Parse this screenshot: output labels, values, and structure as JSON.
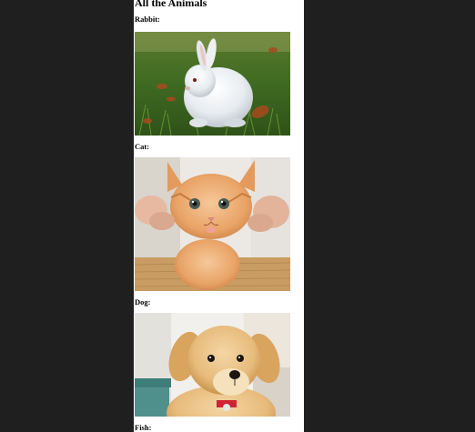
{
  "page": {
    "title": "All the Animals"
  },
  "animals": [
    {
      "label": "Rabbit:",
      "photo_icon": "rabbit-photo"
    },
    {
      "label": "Cat:",
      "photo_icon": "cat-photo"
    },
    {
      "label": "Dog:",
      "photo_icon": "dog-photo"
    },
    {
      "label": "Fish:",
      "photo_icon": "fish-photo"
    }
  ],
  "colors": {
    "outer_background": "#1f1f1f",
    "page_background": "#ffffff",
    "text": "#000000"
  }
}
